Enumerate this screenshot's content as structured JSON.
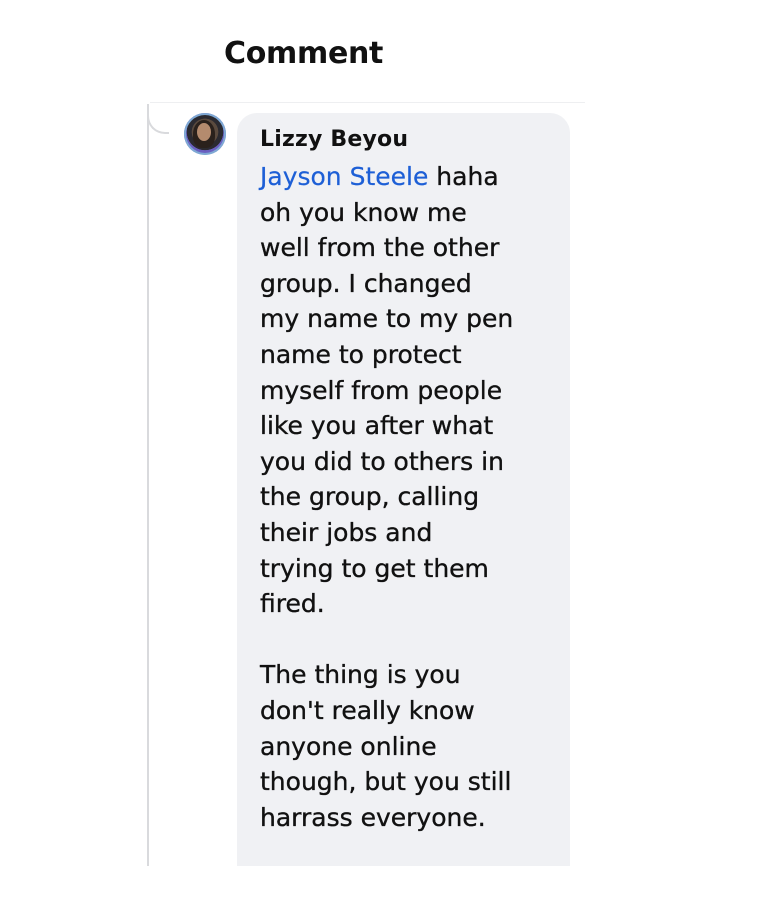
{
  "header": {
    "title": "Comment"
  },
  "comment": {
    "author": "Lizzy Beyou",
    "mention": "Jayson Steele",
    "first_line_rest": " haha",
    "paragraph1_lines": [
      "oh you know me",
      "well from the other",
      "group. I changed",
      "my name to my pen",
      "name to protect",
      "myself from people",
      "like you after what",
      "you did to others in",
      "the group, calling",
      "their jobs and",
      "trying to get them",
      "fired."
    ],
    "paragraph2_lines": [
      "The thing is you",
      "don't really know",
      "anyone online",
      "though, but you still",
      "harrass everyone."
    ]
  },
  "colors": {
    "mention": "#1d5fd6",
    "bubble": "#f0f1f4",
    "text": "#111111",
    "thread_line": "#d9dadd"
  },
  "icons": {
    "avatar": "profile-photo"
  }
}
